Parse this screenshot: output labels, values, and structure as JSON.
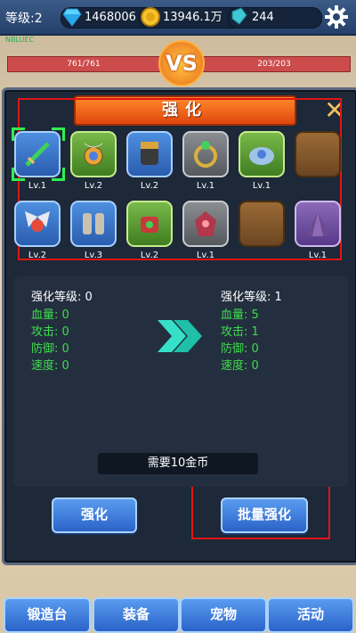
{
  "top": {
    "level": "等级:2",
    "gems": "1468006",
    "gold": "13946.1万",
    "crystals": "244"
  },
  "battle": {
    "tag": "NBLUEC",
    "left_hp": "761/761",
    "right_hp": "203/203",
    "vs": "VS"
  },
  "panel": {
    "title": "强化"
  },
  "items_row1": [
    {
      "rarity": "blue",
      "icon": "sword-icon",
      "level": "Lv.1"
    },
    {
      "rarity": "green",
      "icon": "amulet-icon",
      "level": "Lv.2"
    },
    {
      "rarity": "blue",
      "icon": "gauntlet-icon",
      "level": "Lv.2"
    },
    {
      "rarity": "grey",
      "icon": "ring-icon",
      "level": "Lv.1"
    },
    {
      "rarity": "green",
      "icon": "pauldron-icon",
      "level": "Lv.1"
    },
    {
      "rarity": "empty",
      "icon": "",
      "level": ""
    }
  ],
  "items_row2": [
    {
      "rarity": "blue",
      "icon": "winged-emblem-icon",
      "level": "Lv.2"
    },
    {
      "rarity": "blue",
      "icon": "boots-icon",
      "level": "Lv.3"
    },
    {
      "rarity": "green",
      "icon": "bracer-icon",
      "level": "Lv.2"
    },
    {
      "rarity": "grey",
      "icon": "spiked-armor-icon",
      "level": "Lv.1"
    },
    {
      "rarity": "empty",
      "icon": "",
      "level": ""
    },
    {
      "rarity": "purple",
      "icon": "cloak-icon",
      "level": "Lv.1"
    }
  ],
  "current": {
    "level": "强化等级: 0",
    "hp": "血量: 0",
    "atk": "攻击: 0",
    "def": "防御: 0",
    "spd": "速度: 0"
  },
  "next": {
    "level": "强化等级: 1",
    "hp": "血量: 5",
    "atk": "攻击: 1",
    "def": "防御: 0",
    "spd": "速度: 0"
  },
  "cost": "需要10金币",
  "buttons": {
    "enhance": "强化",
    "batch": "批量强化"
  },
  "nav": [
    "锻造台",
    "装备",
    "宠物",
    "活动"
  ],
  "colors": {
    "accent": "#e0460e",
    "button": "#2a63c8",
    "highlight": "#e01515",
    "stat_green": "#3fdc4c"
  }
}
